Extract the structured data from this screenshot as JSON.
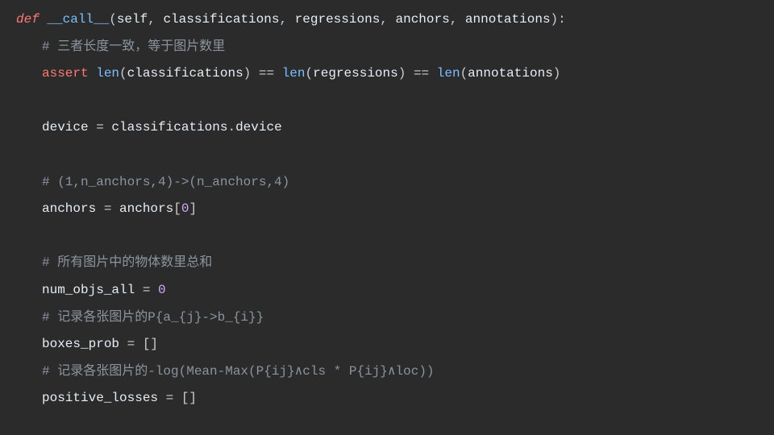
{
  "code": {
    "line1": {
      "def": "def ",
      "name": "__call__",
      "params_open": "(",
      "p_self": "self",
      "sep1": ", ",
      "p1": "classifications",
      "sep2": ", ",
      "p2": "regressions",
      "sep3": ", ",
      "p3": "anchors",
      "sep4": ", ",
      "p4": "annotations",
      "params_close": "):"
    },
    "line2": {
      "comment": "# 三者长度一致，等于图片数里"
    },
    "line3": {
      "assert": "assert ",
      "len1": "len",
      "open1": "(",
      "arg1": "classifications",
      "close1": ") ",
      "eq1": "== ",
      "len2": "len",
      "open2": "(",
      "arg2": "regressions",
      "close2": ") ",
      "eq2": "== ",
      "len3": "len",
      "open3": "(",
      "arg3": "annotations",
      "close3": ")"
    },
    "line5": {
      "var": "device ",
      "eq": "= ",
      "obj": "classifications",
      "dot": ".",
      "attr": "device"
    },
    "line7": {
      "comment": "# (1,n_anchors,4)->(n_anchors,4)"
    },
    "line8": {
      "var": "anchors ",
      "eq": "= ",
      "rhs": "anchors",
      "open": "[",
      "idx": "0",
      "close": "]"
    },
    "line10": {
      "comment": "# 所有图片中的物体数里总和"
    },
    "line11": {
      "var": "num_objs_all ",
      "eq": "= ",
      "val": "0"
    },
    "line12": {
      "comment": "# 记录各张图片的P{a_{j}->b_{i}}"
    },
    "line13": {
      "var": "boxes_prob ",
      "eq": "= ",
      "val": "[]"
    },
    "line14": {
      "comment": "# 记录各张图片的-log(Mean-Max(P{ij}∧cls * P{ij}∧loc))"
    },
    "line15": {
      "var": "positive_losses ",
      "eq": "= ",
      "val": "[]"
    }
  }
}
